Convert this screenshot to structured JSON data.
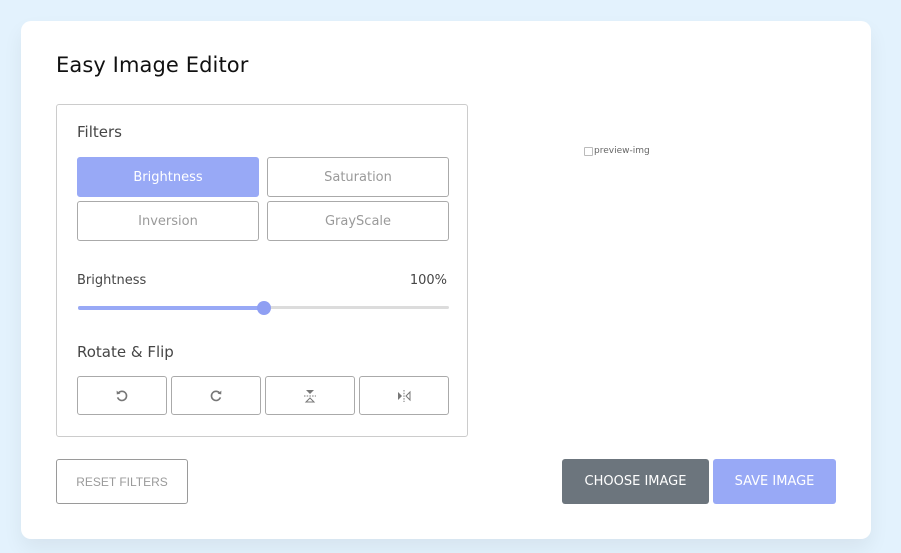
{
  "app": {
    "title": "Easy Image Editor"
  },
  "filters": {
    "label": "Filters",
    "buttons": [
      {
        "label": "Brightness",
        "active": true
      },
      {
        "label": "Saturation",
        "active": false
      },
      {
        "label": "Inversion",
        "active": false
      },
      {
        "label": "GrayScale",
        "active": false
      }
    ]
  },
  "slider": {
    "name": "Brightness",
    "value_text": "100%",
    "fraction": 0.5
  },
  "rotate": {
    "label": "Rotate & Flip",
    "buttons": [
      "rotate-left-icon",
      "rotate-right-icon",
      "flip-vertical-icon",
      "flip-horizontal-icon"
    ]
  },
  "preview": {
    "alt": "preview-img"
  },
  "actions": {
    "reset_label": "RESET FILTERS",
    "choose_label": "CHOOSE IMAGE",
    "save_label": "SAVE IMAGE"
  },
  "colors": {
    "accent": "#98a9f6",
    "dark_button": "#6c757d",
    "background": "#e3f2fd"
  }
}
